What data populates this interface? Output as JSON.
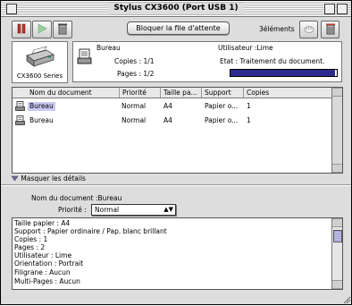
{
  "window": {
    "title": "Stylus CX3600 (Port USB 1)"
  },
  "toolbar": {
    "pause_icon": "pause-icon",
    "resume_icon": "play-icon",
    "delete_icon": "trash-icon",
    "hold_queue_label": "Bloquer la file d'attente",
    "count_label": "3éléments",
    "hold_icon": "hand-icon",
    "trash_icon": "trash-icon"
  },
  "printer": {
    "name": "CX3600 Series"
  },
  "current_job": {
    "name": "Bureau",
    "user": "Utilisateur :Lime",
    "copies": "Copies : 1/1",
    "status": "Etat : Traitement du document.",
    "pages": "Pages : 1/2",
    "progress": 0.98
  },
  "table": {
    "columns": [
      "Nom du document",
      "Priorité",
      "Taille pa...",
      "Support",
      "Copies"
    ],
    "rows": [
      {
        "name": "Bureau",
        "priority": "Normal",
        "size": "A4",
        "support": "Papier o...",
        "copies": "1"
      },
      {
        "name": "Bureau",
        "priority": "Normal",
        "size": "A4",
        "support": "Papier o...",
        "copies": "1"
      }
    ]
  },
  "details": {
    "toggle_label": "Masquer les détails",
    "doc_name": "Nom du document :Bureau",
    "priority_label": "Priorité :",
    "priority_value": "Normal",
    "lines": [
      "Taille papier : A4",
      "Support : Papier ordinaire / Pap. blanc brillant",
      "Copies : 1",
      "Pages : 2",
      "Utilisateur : Lime",
      "Orientation : Portrait",
      "Filigrane : Aucun",
      "Multi-Pages : Aucun"
    ]
  },
  "colors": {
    "window_bg": "#dddddd",
    "progress_fill": "#2c2c8f",
    "scroll_thumb": "#9b9bd0"
  }
}
